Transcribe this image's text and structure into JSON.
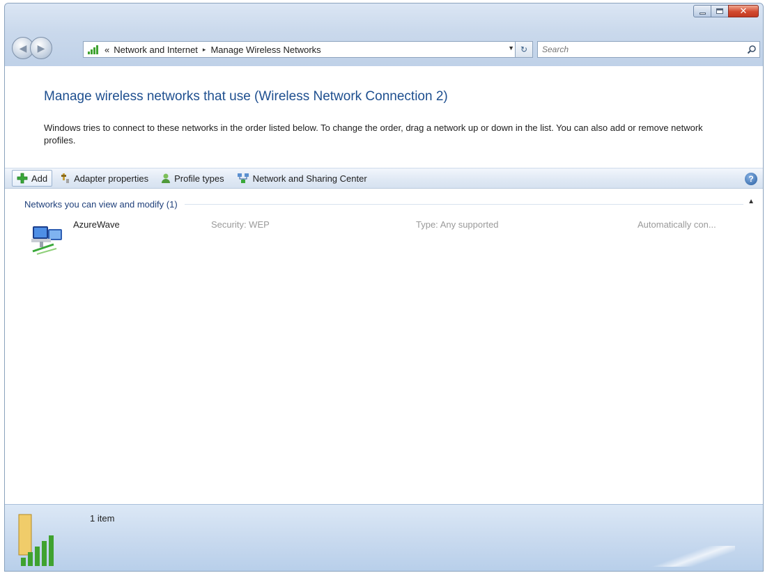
{
  "address_bar": {
    "overflow_chevron": "«",
    "crumbs": [
      "Network and Internet",
      "Manage Wireless Networks"
    ],
    "separator": "▸"
  },
  "search": {
    "placeholder": "Search"
  },
  "page": {
    "heading": "Manage wireless networks that use (Wireless Network Connection 2)",
    "description": "Windows tries to connect to these networks in the order listed below. To change the order, drag a network up or down in the list. You can also add or remove network profiles."
  },
  "toolbar": {
    "add": "Add",
    "adapter_properties": "Adapter properties",
    "profile_types": "Profile types",
    "network_sharing_center": "Network and Sharing Center"
  },
  "group": {
    "label": "Networks you can view and modify (1)"
  },
  "networks": [
    {
      "name": "AzureWave",
      "security": "Security: WEP",
      "type": "Type: Any supported",
      "mode": "Automatically con..."
    }
  ],
  "details": {
    "count": "1 item"
  },
  "icons": {
    "back": "back-arrow-icon",
    "forward": "forward-arrow-icon",
    "search": "search-icon",
    "help": "help-icon",
    "wireless": "wireless-network-icon"
  },
  "colors": {
    "heading": "#1e4f8f",
    "chrome": "#c8d9ee",
    "close_button": "#d2492f",
    "signal_green": "#3fa22f"
  }
}
